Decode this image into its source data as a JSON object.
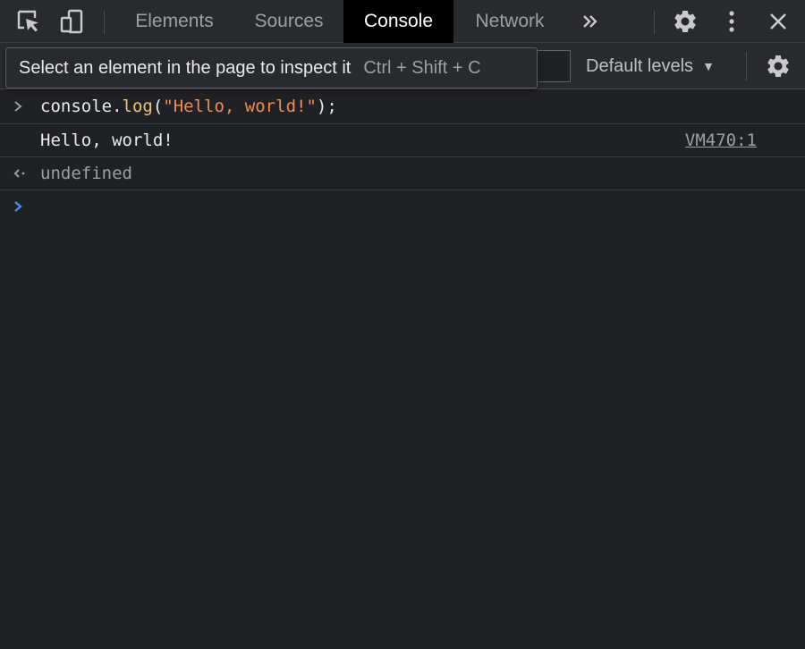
{
  "tabs": [
    {
      "label": "Elements",
      "active": false
    },
    {
      "label": "Sources",
      "active": false
    },
    {
      "label": "Console",
      "active": true
    },
    {
      "label": "Network",
      "active": false
    }
  ],
  "toolbar": {
    "levels_label": "Default levels",
    "filter_value": ""
  },
  "tooltip": {
    "text": "Select an element in the page to inspect it",
    "shortcut": "Ctrl + Shift + C"
  },
  "console": {
    "input_line": {
      "object": "console.",
      "method": "log",
      "open": "(",
      "string": "\"Hello, world!\"",
      "close": ");"
    },
    "output_line": {
      "text": "Hello, world!",
      "source": "VM470:1"
    },
    "result_line": {
      "text": "undefined"
    },
    "prompt_value": ""
  },
  "icons": {
    "inspect": "inspect-element-icon",
    "device": "device-toolbar-icon",
    "more_tabs": "chevron-double-right-icon",
    "settings": "gear-icon",
    "menu": "kebab-menu-icon",
    "close": "close-icon",
    "console_settings": "gear-icon"
  },
  "colors": {
    "background": "#202124",
    "toolbar": "#292a2d",
    "active_tab": "#000000",
    "string": "#f28b54",
    "method": "#e8c67a",
    "prompt_accent": "#4c8ef7"
  }
}
